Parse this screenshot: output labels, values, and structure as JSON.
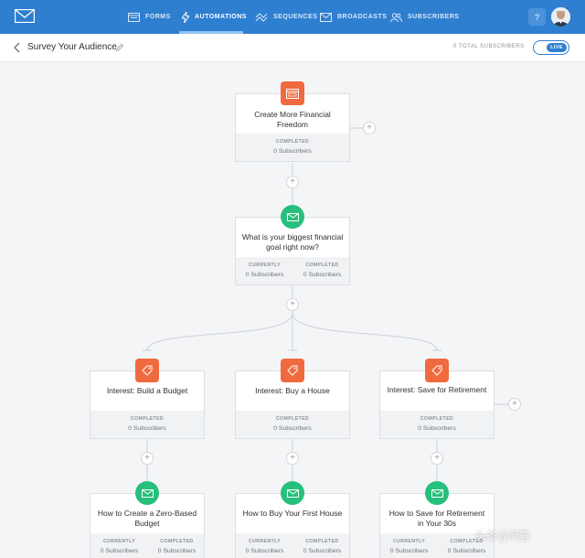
{
  "nav": {
    "items": [
      {
        "label": "FORMS",
        "icon": "forms-icon"
      },
      {
        "label": "AUTOMATIONS",
        "icon": "lightning-icon",
        "active": true
      },
      {
        "label": "SEQUENCES",
        "icon": "sequences-icon"
      },
      {
        "label": "BROADCASTS",
        "icon": "mail-icon"
      },
      {
        "label": "SUBSCRIBERS",
        "icon": "users-icon"
      }
    ],
    "help_label": "?"
  },
  "header": {
    "title": "Survey Your Audience",
    "subscribers": "0 TOTAL SUBSCRIBERS",
    "live_label": "LIVE"
  },
  "nodes": {
    "n1": {
      "title": "Create More Financial Freedom",
      "icon": "form-icon",
      "stats": [
        {
          "label": "COMPLETED",
          "value": "0 Subscribers"
        }
      ]
    },
    "n2": {
      "title": "What is your biggest financial goal right now?",
      "icon": "email-icon",
      "stats": [
        {
          "label": "CURRENTLY",
          "value": "0 Subscribers"
        },
        {
          "label": "COMPLETED",
          "value": "0 Subscribers"
        }
      ]
    },
    "t1": {
      "title": "Interest: Build a Budget",
      "icon": "tag-icon",
      "stats": [
        {
          "label": "COMPLETED",
          "value": "0 Subscribers"
        }
      ]
    },
    "t2": {
      "title": "Interest: Buy a House",
      "icon": "tag-icon",
      "stats": [
        {
          "label": "COMPLETED",
          "value": "0 Subscribers"
        }
      ]
    },
    "t3": {
      "title": "Interest: Save for Retirement",
      "icon": "tag-icon",
      "stats": [
        {
          "label": "COMPLETED",
          "value": "0 Subscribers"
        }
      ]
    },
    "e1": {
      "title": "How to Create a Zero-Based Budget",
      "icon": "email-icon",
      "stats": [
        {
          "label": "CURRENTLY",
          "value": "0 Subscribers"
        },
        {
          "label": "COMPLETED",
          "value": "0 Subscribers"
        }
      ]
    },
    "e2": {
      "title": "How to Buy Your First House",
      "icon": "email-icon",
      "stats": [
        {
          "label": "CURRENTLY",
          "value": "0 Subscribers"
        },
        {
          "label": "COMPLETED",
          "value": "0 Subscribers"
        }
      ]
    },
    "e3": {
      "title": "How to Save for Retirement in Your 30s",
      "icon": "email-icon",
      "stats": [
        {
          "label": "CURRENTLY",
          "value": "0 Subscribers"
        },
        {
          "label": "COMPLETED",
          "value": "0 Subscribers"
        }
      ]
    }
  },
  "plus_label": "+",
  "watermark": "头条@问答",
  "colors": {
    "nav": "#2f7fd0",
    "tag": "#ef6a3e",
    "email": "#27bf7c",
    "form": "#ef6a3e"
  }
}
